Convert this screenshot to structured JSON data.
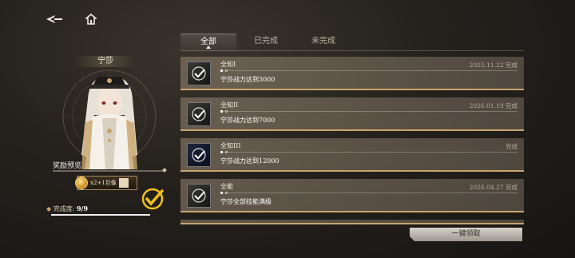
{
  "nav": {
    "back_icon": "back-arrow-icon",
    "home_icon": "home-icon"
  },
  "tabs": [
    {
      "label": "全部",
      "active": true
    },
    {
      "label": "已完成",
      "active": false
    },
    {
      "label": "未完成",
      "active": false
    }
  ],
  "character": {
    "name": "宁莎"
  },
  "reward": {
    "title": "奖励预览",
    "item_text": "x2+1巨像",
    "claimed": true
  },
  "progress": {
    "label": "完成度:",
    "value": "9/9",
    "fraction": 1.0
  },
  "achievements": [
    {
      "title": "全知I",
      "description": "宁莎战力达到3000",
      "date": "2025.11.22 完成",
      "completed": true
    },
    {
      "title": "全知II",
      "description": "宁莎战力达到7000",
      "date": "2026.01.19 完成",
      "completed": true
    },
    {
      "title": "全知III",
      "description": "宁莎战力达到12000",
      "date": "完成",
      "completed": true
    },
    {
      "title": "全能",
      "description": "宁莎全部技能满级",
      "date": "2026.04.27 完成",
      "completed": true
    }
  ],
  "claim_all_button": "一键领取",
  "colors": {
    "accent_gold": "#c9a46c",
    "check_yellow": "#f2c21a"
  }
}
